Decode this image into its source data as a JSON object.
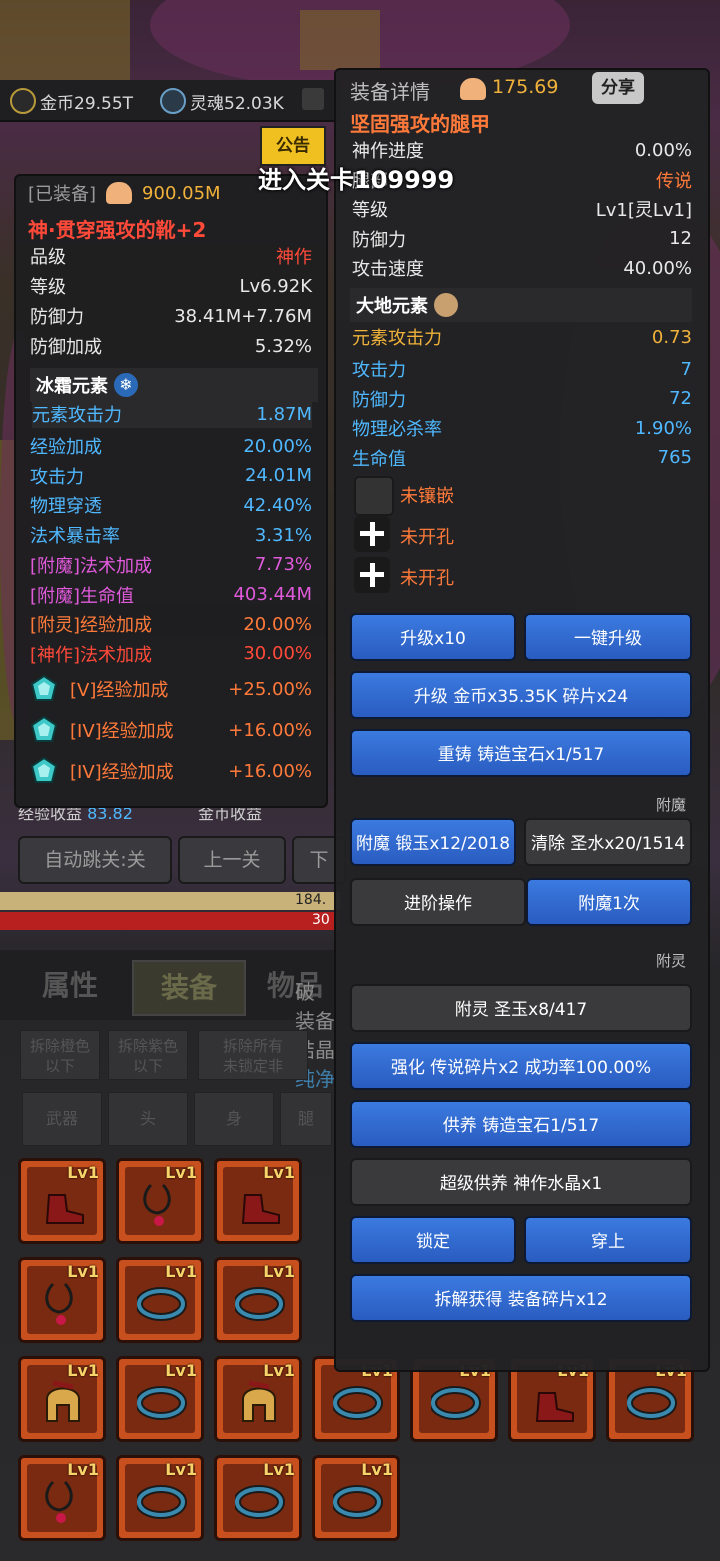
{
  "top_bar": {
    "gold": "金币29.55T",
    "soul": "灵魂52.03K",
    "notice": "公告",
    "enter_stage": "进入关卡109999"
  },
  "background": {
    "exp_gain": "经验收益",
    "exp_value": "83.82",
    "gold_gain": "金币收益",
    "auto_skip": "自动跳关:关",
    "prev_stage": "上一关",
    "next_stage": "下",
    "hp_value": "184.",
    "hp_value2": "30",
    "tabs": [
      "属性",
      "装备",
      "物品"
    ],
    "side_text": [
      "破",
      "装备",
      "结晶",
      "纯净"
    ],
    "filters": [
      "拆除橙色\n以下",
      "拆除紫色\n以下",
      "拆除所有\n未锁定非"
    ],
    "slots": [
      "武器",
      "头",
      "身",
      "腿"
    ],
    "item_level": "Lv1"
  },
  "equipped": {
    "header": "[已装备]",
    "power": "900.05M",
    "name": "神·贯穿强攻的靴+2",
    "stats": [
      {
        "k": "品级",
        "v": "神作",
        "color": "#ff4a3a"
      },
      {
        "k": "等级",
        "v": "Lv6.92K",
        "color": "#e8e8e8"
      },
      {
        "k": "防御力",
        "v": "38.41M+7.76M",
        "color": "#e8e8e8"
      },
      {
        "k": "防御加成",
        "v": "5.32%",
        "color": "#e8e8e8"
      }
    ],
    "element": {
      "name": "冰霜元素",
      "attack_label": "元素攻击力",
      "attack_value": "1.87M"
    },
    "attrs": [
      {
        "k": "经验加成",
        "v": "20.00%",
        "color": "#4fb8ff"
      },
      {
        "k": "攻击力",
        "v": "24.01M",
        "color": "#4fb8ff"
      },
      {
        "k": "物理穿透",
        "v": "42.40%",
        "color": "#4fb8ff"
      },
      {
        "k": "法术暴击率",
        "v": "3.31%",
        "color": "#4fb8ff"
      },
      {
        "k": "[附魔]法术加成",
        "v": "7.73%",
        "color": "#e05adc"
      },
      {
        "k": "[附魔]生命值",
        "v": "403.44M",
        "color": "#e05adc"
      },
      {
        "k": "[附灵]经验加成",
        "v": "20.00%",
        "color": "#ff7a3a"
      },
      {
        "k": "[神作]法术加成",
        "v": "30.00%",
        "color": "#ff4a3a"
      }
    ],
    "crystals": [
      {
        "k": "[V]经验加成",
        "v": "+25.00%"
      },
      {
        "k": "[IV]经验加成",
        "v": "+16.00%"
      },
      {
        "k": "[IV]经验加成",
        "v": "+16.00%"
      }
    ]
  },
  "detail": {
    "title": "装备详情",
    "power": "175.69",
    "share": "分享",
    "name": "坚固强攻的腿甲",
    "stats": [
      {
        "k": "神作进度",
        "v": "0.00%",
        "color": "#e8e8e8"
      },
      {
        "k": "腿部",
        "v": "传说",
        "color": "#ff7a3a"
      },
      {
        "k": "等级",
        "v": "Lv1[灵Lv1]",
        "color": "#e8e8e8"
      },
      {
        "k": "防御力",
        "v": "12",
        "color": "#e8e8e8"
      },
      {
        "k": "攻击速度",
        "v": "40.00%",
        "color": "#e8e8e8"
      }
    ],
    "element": {
      "name": "大地元素",
      "attack_label": "元素攻击力",
      "attack_value": "0.73"
    },
    "attrs": [
      {
        "k": "攻击力",
        "v": "7"
      },
      {
        "k": "防御力",
        "v": "72"
      },
      {
        "k": "物理必杀率",
        "v": "1.90%"
      },
      {
        "k": "生命值",
        "v": "765"
      }
    ],
    "sockets": [
      "未镶嵌",
      "未开孔",
      "未开孔"
    ],
    "buttons": {
      "upgrade10": "升级x10",
      "one_click": "一键升级",
      "upgrade": "升级 金币x35.35K 碎片x24",
      "reforge": "重铸 铸造宝石x1/517",
      "enchant_section": "附魔",
      "enchant": "附魔 锻玉x12/2018",
      "clear": "清除 圣水x20/1514",
      "advanced": "进阶操作",
      "enchant_once": "附魔1次",
      "spirit_section": "附灵",
      "spirit": "附灵 圣玉x8/417",
      "strengthen": "强化 传说碎片x2 成功率100.00%",
      "nurture": "供养 铸造宝石1/517",
      "super_nurture": "超级供养 神作水晶x1",
      "lock": "锁定",
      "wear": "穿上",
      "dismantle": "拆解获得 装备碎片x12"
    }
  }
}
